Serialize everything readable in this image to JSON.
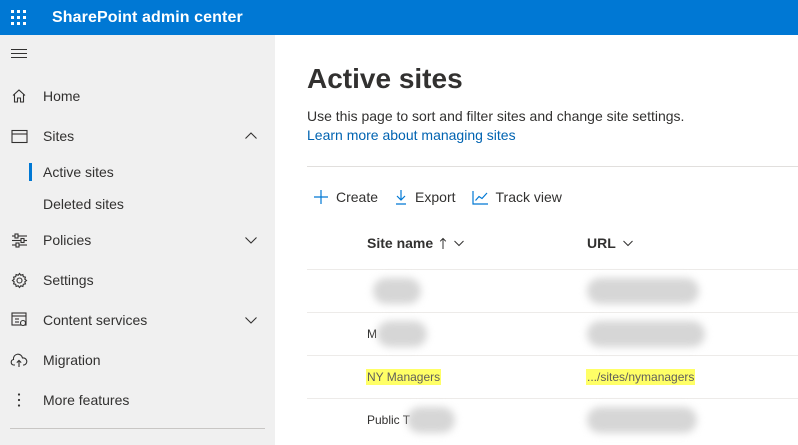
{
  "app": {
    "title": "SharePoint admin center"
  },
  "sidebar": {
    "items": [
      {
        "label": "Home",
        "icon": "home-icon"
      },
      {
        "label": "Sites",
        "icon": "sites-icon",
        "expanded": true
      },
      {
        "label": "Active sites",
        "sub": true,
        "active": true
      },
      {
        "label": "Deleted sites",
        "sub": true
      },
      {
        "label": "Policies",
        "icon": "policies-icon"
      },
      {
        "label": "Settings",
        "icon": "settings-icon"
      },
      {
        "label": "Content services",
        "icon": "content-services-icon"
      },
      {
        "label": "Migration",
        "icon": "migration-icon"
      },
      {
        "label": "More features",
        "icon": "more-icon"
      }
    ]
  },
  "main": {
    "title": "Active sites",
    "description": "Use this page to sort and filter sites and change site settings.",
    "learn_more": "Learn more about managing sites",
    "commands": [
      "Create",
      "Export",
      "Track view"
    ],
    "columns": {
      "site_name": "Site name",
      "url": "URL"
    },
    "rows": [
      {
        "name": "",
        "url": ""
      },
      {
        "name": "M",
        "url": ""
      },
      {
        "name": "NY Managers",
        "url": ".../sites/nymanagers",
        "highlighted": true
      },
      {
        "name": "Public T",
        "url": ""
      }
    ]
  },
  "colors": {
    "accent": "#0078d4",
    "link": "#0063b1",
    "highlight": "#ffff66",
    "sidebar_bg": "#f0f0f0"
  }
}
